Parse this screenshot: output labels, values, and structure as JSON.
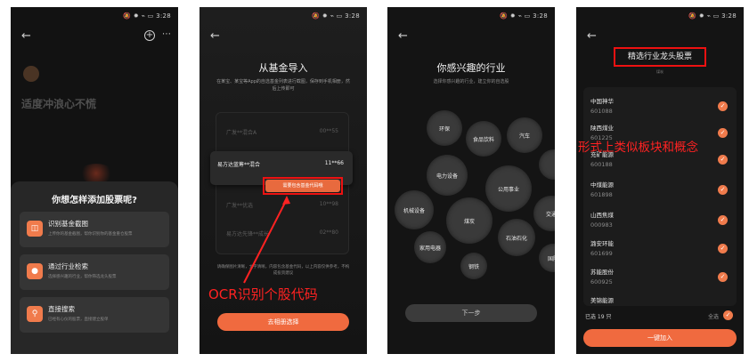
{
  "status_bar": "🔕 ✹ ⌁ ▭ 3:28",
  "screen1": {
    "motto": "适度冲浪心不慌",
    "sheet_title": "你想怎样添加股票呢?",
    "options": [
      {
        "title": "识别基金截图",
        "desc": "上传你的基金截图，帮你识别你的基金重仓股票"
      },
      {
        "title": "通过行业检索",
        "desc": "选择感兴趣的行业，帮你筛选龙头股票"
      },
      {
        "title": "直接搜索",
        "desc": "已经有心仪的股票，直接建立股单"
      }
    ]
  },
  "screen2": {
    "title": "从基金导入",
    "subtitle": "在某宝、某宝等App的自选基金列表进行截图，保存到手机相册，然后上传即可",
    "funds": [
      {
        "name": "广发**混合A",
        "code": "00**55"
      },
      {
        "name": "易方达蓝筹**混合",
        "code": "11**66"
      },
      {
        "name": "广发**优选",
        "code": "10**98"
      },
      {
        "name": "易方达先锋**成长",
        "code": "02**80"
      }
    ],
    "copy_button": "需要包含基金代码哦",
    "disclaimer": "请确保图片清晰，文字清晰，内容包含基金代码，以上内容仅供参考，不构成投资建议",
    "annotation": "OCR识别个股代码",
    "main_button": "去相册选择"
  },
  "screen3": {
    "title": "你感兴趣的行业",
    "subtitle": "选择你感兴趣的行业，建立你的自选股",
    "bubbles": [
      "环保",
      "食品饮料",
      "汽车",
      "电力设备",
      "公用事业",
      "机械设备",
      "煤炭",
      "交通",
      "家用电器",
      "石油石化",
      "钢铁",
      "国防"
    ],
    "next_button": "下一步"
  },
  "screen4": {
    "title": "精选行业龙头股票",
    "caption": "煤炭",
    "stocks": [
      {
        "name": "中国神华",
        "code": "601088"
      },
      {
        "name": "陕西煤业",
        "code": "601225"
      },
      {
        "name": "充矿能源",
        "code": "600188"
      },
      {
        "name": "中煤能源",
        "code": "601898"
      },
      {
        "name": "山西焦煤",
        "code": "000983"
      },
      {
        "name": "潞安环能",
        "code": "601699"
      },
      {
        "name": "苏能股份",
        "code": "600925"
      },
      {
        "name": "美锦能源",
        "code": ""
      }
    ],
    "annotation": "形式上类似板块和概念",
    "selected_count": "已选 19 只",
    "select_all": "全选",
    "add_button": "一键加入"
  },
  "colors": {
    "accent": "#f06a3f",
    "annotation_red": "#ff2222"
  }
}
